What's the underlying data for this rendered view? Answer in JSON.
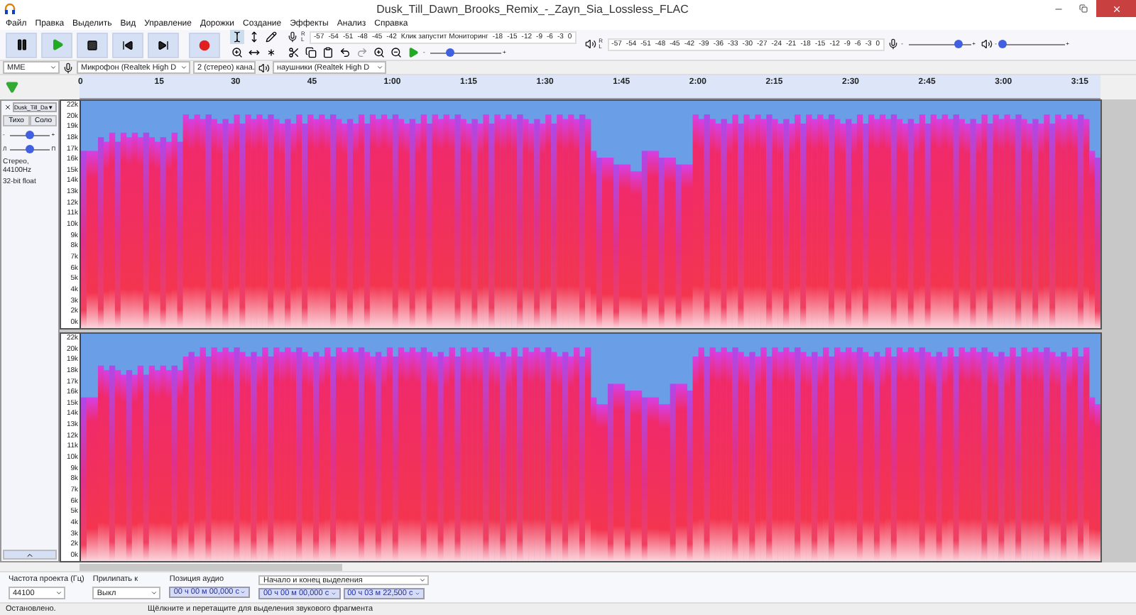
{
  "window": {
    "title": "Dusk_Till_Dawn_Brooks_Remix_-_Zayn_Sia_Lossless_FLAC"
  },
  "menu": [
    "Файл",
    "Правка",
    "Выделить",
    "Вид",
    "Управление",
    "Дорожки",
    "Создание",
    "Эффекты",
    "Анализ",
    "Справка"
  ],
  "toolbar": {
    "record_meter": {
      "channels": "R L",
      "scale": [
        "-57",
        "-54",
        "-51",
        "-48",
        "-45",
        "-42",
        "Клик запустит Мониторинг",
        "-18",
        "-15",
        "-12",
        "-9",
        "-6",
        "-3",
        "0"
      ]
    },
    "play_meter": {
      "channels": "R L",
      "scale": [
        "-57",
        "-54",
        "-51",
        "-48",
        "-45",
        "-42",
        "-39",
        "-36",
        "-33",
        "-30",
        "-27",
        "-24",
        "-21",
        "-18",
        "-15",
        "-12",
        "-9",
        "-6",
        "-3",
        "0"
      ]
    },
    "record_volume": {
      "min": "-",
      "max": "+",
      "level": 0.8
    },
    "play_volume": {
      "min": "-",
      "max": "+",
      "level": 0.0
    },
    "play_speed": {
      "min": "-",
      "max": "+",
      "level": 0.28
    }
  },
  "devices": {
    "host": "MME",
    "microphone": "Микрофон (Realtek High D",
    "channels": "2 (стерео) кана.",
    "speakers": "наушники (Realtek High D"
  },
  "timeline": [
    "0",
    "15",
    "30",
    "45",
    "1:00",
    "1:15",
    "1:30",
    "1:45",
    "2:00",
    "2:15",
    "2:30",
    "2:45",
    "3:00",
    "3:15"
  ],
  "track": {
    "name": "Dusk_Till_Da▼",
    "mute": "Тихо",
    "solo": "Соло",
    "gain": {
      "min": "-",
      "max": "+",
      "level": 0.5
    },
    "pan": {
      "min": "Л",
      "max": "П",
      "level": 0.5
    },
    "info": [
      "Стерео, 44100Hz",
      "32-bit float"
    ],
    "channels": [
      {
        "freq_labels": [
          "22k",
          "20k",
          "19k",
          "18k",
          "17k",
          "16k",
          "15k",
          "14k",
          "13k",
          "12k",
          "11k",
          "10k",
          "9k",
          "8k",
          "7k",
          "6k",
          "5k",
          "4k",
          "3k",
          "2k",
          "0k"
        ]
      },
      {
        "freq_labels": [
          "22k",
          "20k",
          "19k",
          "18k",
          "17k",
          "16k",
          "15k",
          "14k",
          "13k",
          "12k",
          "11k",
          "10k",
          "9k",
          "8k",
          "7k",
          "6k",
          "5k",
          "4k",
          "3k",
          "2k",
          "0k"
        ]
      }
    ]
  },
  "selection_bar": {
    "rate_label": "Частота проекта (Гц)",
    "rate": "44100",
    "snap_label": "Прилипать к",
    "snap": "Выкл",
    "position_label": "Позиция аудио",
    "position": "00 ч 00 м 00,000 с",
    "range_mode": "Начало и конец выделения",
    "start": "00 ч 00 м 00,000 с",
    "end": "00 ч 03 м 22,500 с"
  },
  "status_bar": {
    "state": "Остановлено.",
    "hint": "Щёлкните и перетащите для выделения звукового фрагмента"
  }
}
